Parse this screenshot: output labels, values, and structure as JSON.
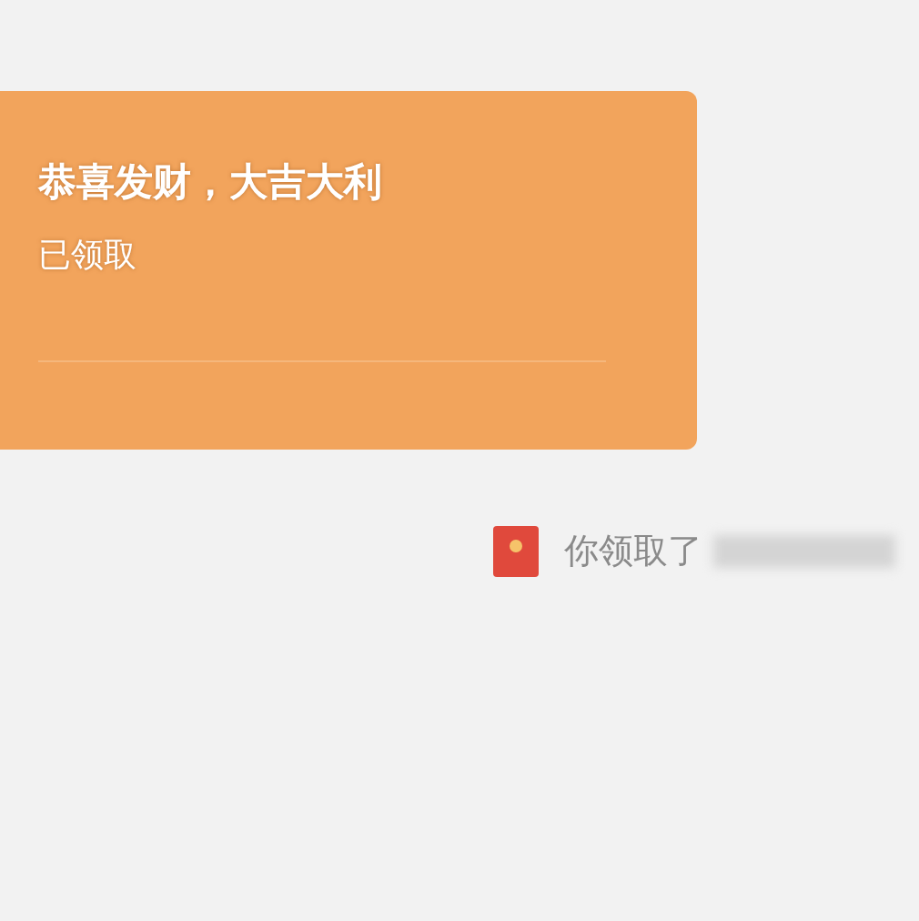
{
  "red_packet": {
    "greeting": "恭喜发财，大吉大利",
    "status": "已领取"
  },
  "notice": {
    "text": "你领取了"
  }
}
